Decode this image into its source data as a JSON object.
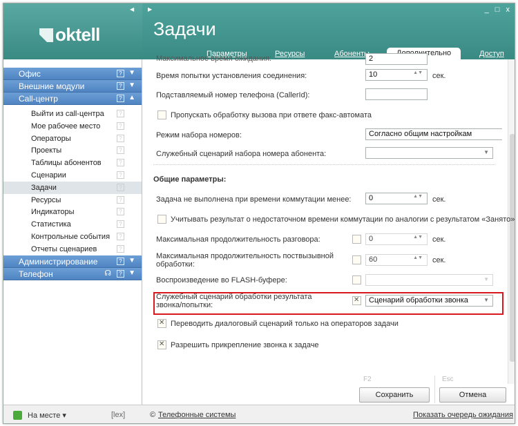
{
  "app": {
    "logo": "oktell",
    "title": "Задачи",
    "window_controls": "_ □ x"
  },
  "tabs": [
    {
      "label": "Параметры"
    },
    {
      "label": "Ресурсы"
    },
    {
      "label": "Абоненты"
    },
    {
      "label": "Дополнительно"
    },
    {
      "label": "Доступ"
    }
  ],
  "sidebar": {
    "sections": [
      {
        "label": "Офис"
      },
      {
        "label": "Внешние модули"
      },
      {
        "label": "Call-центр"
      },
      {
        "label": "Администрирование"
      },
      {
        "label": "Телефон"
      }
    ],
    "items": [
      {
        "label": "Выйти из call-центра"
      },
      {
        "label": "Мое рабочее место"
      },
      {
        "label": "Операторы"
      },
      {
        "label": "Проекты"
      },
      {
        "label": "Таблицы абонентов"
      },
      {
        "label": "Сценарии"
      },
      {
        "label": "Задачи"
      },
      {
        "label": "Ресурсы"
      },
      {
        "label": "Индикаторы"
      },
      {
        "label": "Статистика"
      },
      {
        "label": "Контрольные события"
      },
      {
        "label": "Отчеты сценариев"
      }
    ],
    "help_glyph": "?"
  },
  "form": {
    "cut_label": "Максимальное время ожидания:",
    "cut_value": "2",
    "connect_time_label": "Время попытки установления соединения:",
    "connect_time_value": "10",
    "unit_sec": "сек.",
    "callerid_label": "Подставляемый номер телефона (CallerId):",
    "callerid_value": "",
    "skip_fax_label": "Пропускать обработку вызова при ответе факс-автомата",
    "dial_mode_label": "Режим набора номеров:",
    "dial_mode_value": "Согласно общим настройкам",
    "dial_script_label": "Служебный сценарий набора номера абонента:",
    "dial_script_value": "",
    "general_header": "Общие параметры:",
    "fail_label": "Задача не выполнена при времени коммутации менее:",
    "fail_value": "0",
    "busy_analog_label": "Учитывать результат о недостаточном времени коммутации по аналогии с результатом «Занято»",
    "max_talk_label": "Максимальная продолжительность разговора:",
    "max_talk_value": "0",
    "max_post_label1": "Максимальная продолжительность поствызывной",
    "max_post_label2": "обработки:",
    "max_post_value": "60",
    "flash_label": "Воспроизведение во FLASH-буфере:",
    "flash_value": "",
    "result_script_label1": "Служебный сценарий обработки результата",
    "result_script_label2": "звонка/попытки:",
    "result_script_value": "Сценарий обработки звонка",
    "dialog_ops_label": "Переводить диалоговый сценарий только на операторов задачи",
    "attach_label": "Разрешить прикрепление звонка к задаче"
  },
  "buttons": {
    "save_key": "F2",
    "save": "Сохранить",
    "cancel_key": "Esc",
    "cancel": "Отмена"
  },
  "status": {
    "presence": "На месте ▾",
    "user": "[lex]",
    "company": "Телефонные системы",
    "company_prefix": "©",
    "show_queue": "Показать очередь ожидания"
  }
}
